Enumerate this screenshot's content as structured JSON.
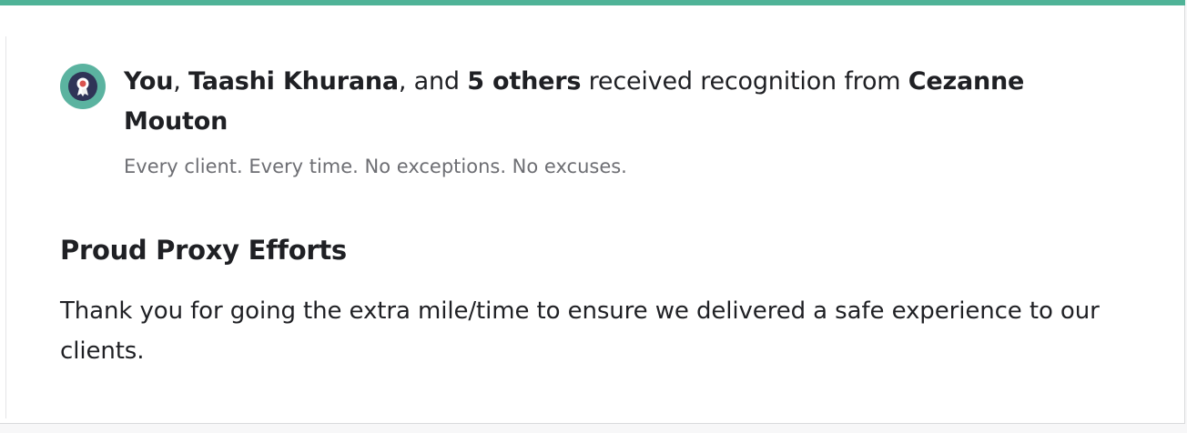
{
  "recognition": {
    "header": {
      "recipient_you": "You",
      "sep1": ", ",
      "recipient_named": "Taashi Khurana",
      "sep2": ", and ",
      "others": "5 others",
      "received_text": " received recognition from ",
      "giver": "Cezanne Mouton"
    },
    "subtitle": "Every client. Every time. No exceptions. No excuses.",
    "title": "Proud Proxy Efforts",
    "message": "Thank you for going the extra mile/time to ensure we delivered a safe experience to our clients."
  },
  "icons": {
    "avatar": "award-ribbon-icon"
  },
  "colors": {
    "accent": "#4fb397",
    "avatar_bg": "#5bb3a0",
    "avatar_inner": "#2f3457",
    "ribbon": "#d9534f"
  }
}
